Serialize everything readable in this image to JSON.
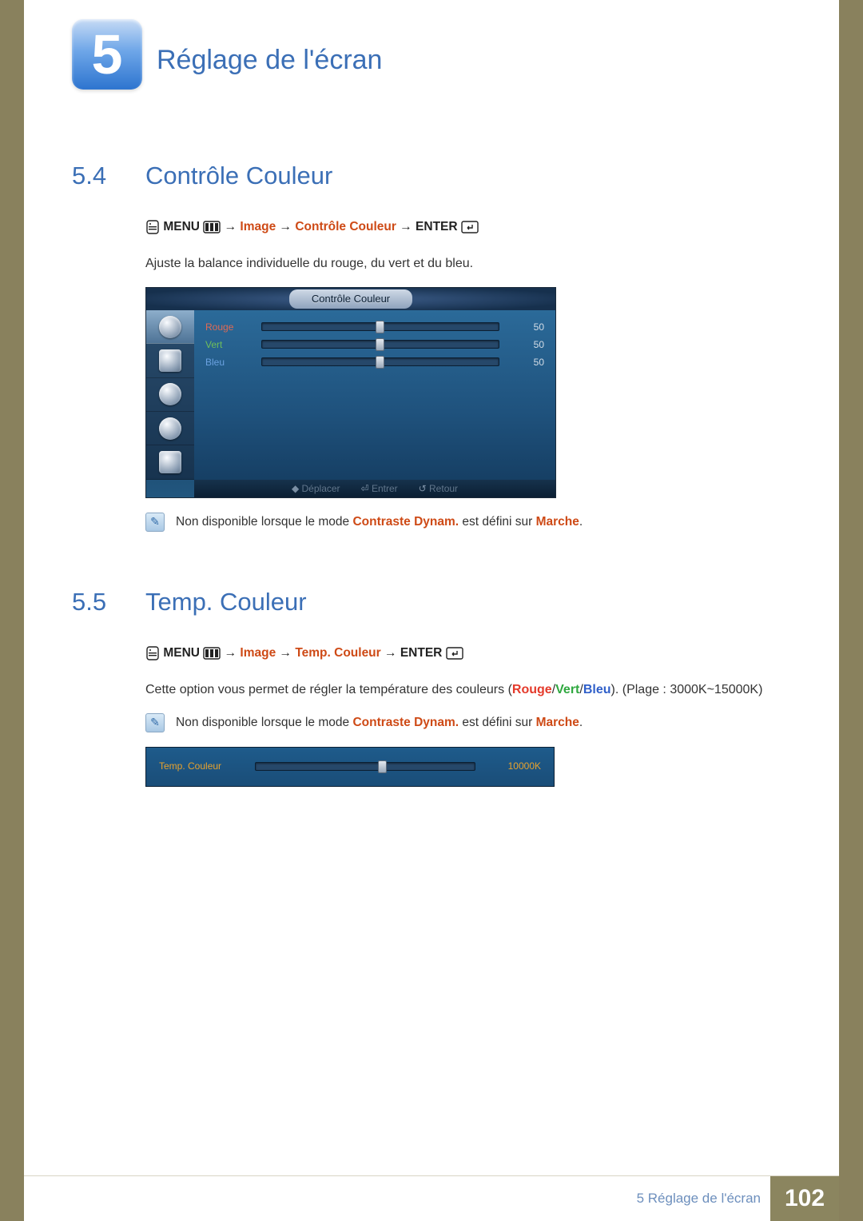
{
  "chapter": {
    "number": "5",
    "title": "Réglage de l'écran"
  },
  "sections": [
    {
      "num": "5.4",
      "title": "Contrôle Couleur",
      "nav": {
        "menu": "MENU",
        "image": "Image",
        "item": "Contrôle Couleur",
        "enter": "ENTER"
      },
      "desc_plain": "Ajuste la balance individuelle du rouge, du vert et du bleu.",
      "osd": {
        "title": "Contrôle Couleur",
        "rows": [
          {
            "label": "Rouge",
            "value": "50",
            "cls": "lbl-red"
          },
          {
            "label": "Vert",
            "value": "50",
            "cls": "lbl-green"
          },
          {
            "label": "Bleu",
            "value": "50",
            "cls": "lbl-blue"
          }
        ],
        "footer": {
          "move": "Déplacer",
          "enter": "Entrer",
          "back": "Retour"
        }
      },
      "note": {
        "pre": "Non disponible lorsque le mode ",
        "bold1": "Contraste Dynam.",
        "mid": " est défini sur ",
        "bold2": "Marche",
        "post": "."
      }
    },
    {
      "num": "5.5",
      "title": "Temp. Couleur",
      "nav": {
        "menu": "MENU",
        "image": "Image",
        "item": "Temp. Couleur",
        "enter": "ENTER"
      },
      "desc_parts": {
        "pre": "Cette option vous permet de régler la température des couleurs (",
        "r": "Rouge",
        "sep1": "/",
        "g": "Vert",
        "sep2": "/",
        "b": "Bleu",
        "post": "). (Plage : 3000K~15000K)"
      },
      "note": {
        "pre": "Non disponible lorsque le mode ",
        "bold1": "Contraste Dynam.",
        "mid": " est défini sur ",
        "bold2": "Marche",
        "post": "."
      },
      "osd2": {
        "label": "Temp. Couleur",
        "value": "10000K"
      }
    }
  ],
  "footer": {
    "text": "5 Réglage de l'écran",
    "page": "102"
  }
}
